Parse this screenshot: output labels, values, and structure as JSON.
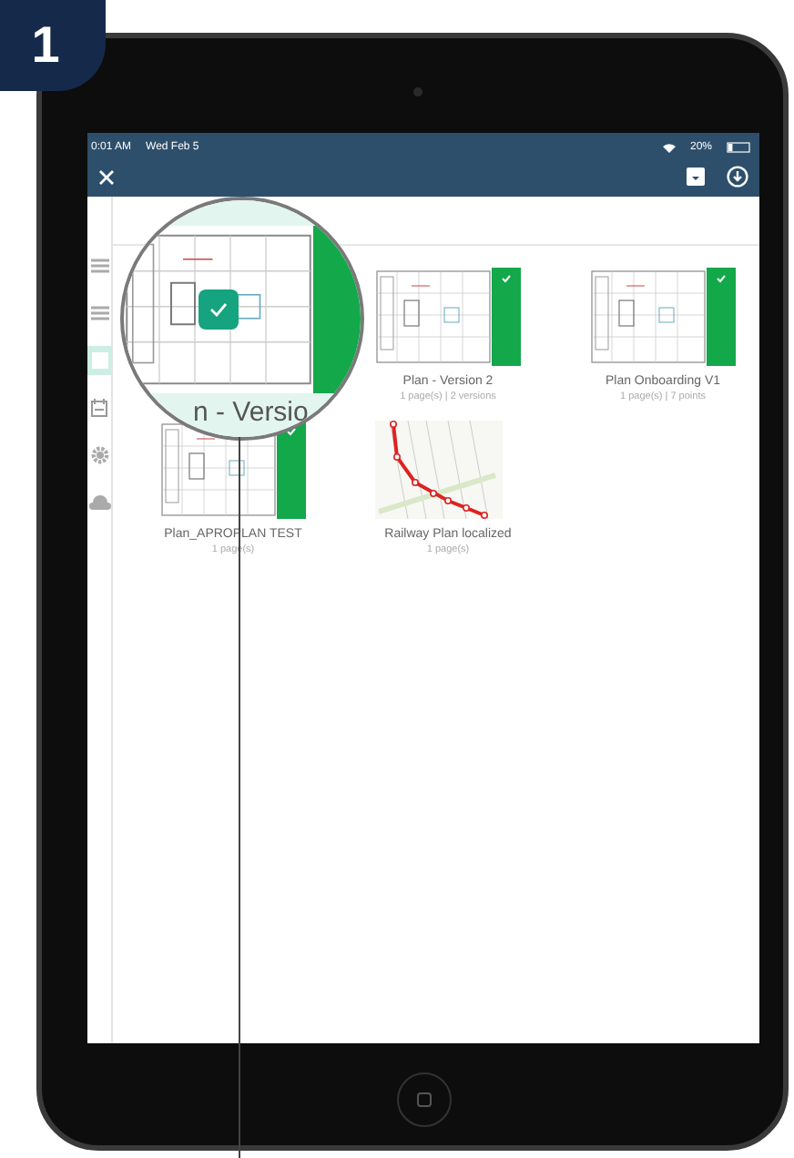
{
  "step_badge": "1",
  "status_bar": {
    "time": "0:01 AM",
    "date": "Wed Feb 5",
    "battery": "20%"
  },
  "sidebar": {
    "items": [
      {
        "kind": "list",
        "selected": false
      },
      {
        "kind": "list",
        "selected": false
      },
      {
        "kind": "plans",
        "selected": true
      },
      {
        "kind": "calendar",
        "selected": false
      },
      {
        "kind": "settings",
        "selected": false
      },
      {
        "kind": "cloud",
        "selected": false
      }
    ]
  },
  "plans": [
    {
      "name": "Plan - Version 2",
      "info": "1 page(s) | 2 versions",
      "kind": "plan",
      "synced": true
    },
    {
      "name": "Plan Onboarding V1",
      "info": "1 page(s) | 7 points",
      "kind": "plan",
      "synced": true
    },
    {
      "name": "Plan_APROPLAN TEST",
      "info": "1 page(s)",
      "kind": "plan",
      "synced": true
    },
    {
      "name": "Railway Plan localized",
      "info": "1 page(s)",
      "kind": "map",
      "synced": false
    }
  ],
  "magnifier": {
    "label": "n - Versio",
    "checked": true
  }
}
